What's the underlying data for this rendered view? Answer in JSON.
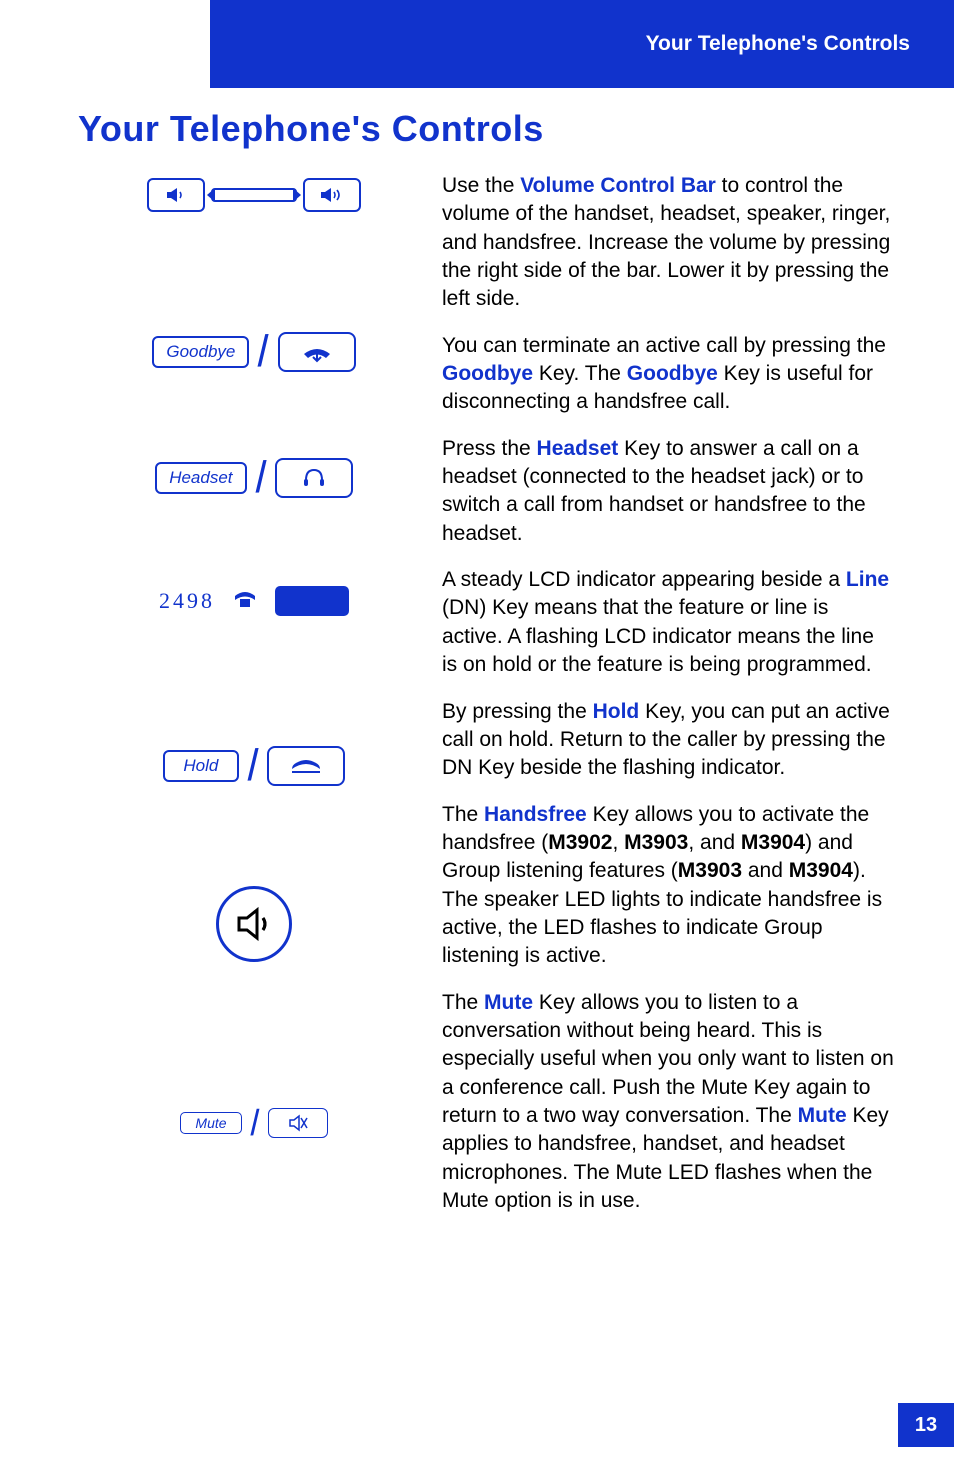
{
  "header": {
    "section": "Your Telephone's Controls"
  },
  "title": "Your Telephone's Controls",
  "keys": {
    "goodbye_label": "Goodbye",
    "headset_label": "Headset",
    "hold_label": "Hold",
    "mute_label": "Mute",
    "line_number": "2498"
  },
  "models": {
    "m3902": "M3902",
    "m3903": "M3903",
    "m3904": "M3904"
  },
  "terms": {
    "volume_bar": "Volume Control Bar",
    "goodbye": "Goodbye",
    "headset": "Headset",
    "line": "Line",
    "hold": "Hold",
    "handsfree": "Handsfree",
    "mute": "Mute"
  },
  "body": {
    "vol_1": "Use the ",
    "vol_2": " to control the volume of the handset, headset, speaker, ringer, and handsfree. Increase the volume by pressing the right side of the bar. Lower it by pressing the left side.",
    "goodbye_1": "You can terminate an active call by pressing the ",
    "goodbye_2": " Key. The ",
    "goodbye_3": " Key is useful for disconnecting a handsfree call.",
    "headset_1": "Press the ",
    "headset_2": " Key to answer a call on a headset (connected to the headset jack) or to switch a call from handset or handsfree to the headset.",
    "line_1": "A steady LCD indicator appearing beside a ",
    "line_2": " (DN) Key means that the feature or line is active. A flashing LCD indicator means the line is on hold or the feature is being programmed.",
    "hold_1": "By pressing the ",
    "hold_2": " Key, you can put an active call on hold. Return to the caller by pressing the DN Key beside the flashing indicator.",
    "hf_1": "The ",
    "hf_2": " Key allows you to activate the handsfree (",
    "hf_3": ", ",
    "hf_4": ", and ",
    "hf_5": ") and Group listening features (",
    "hf_6": " and ",
    "hf_7": "). The speaker LED lights to indicate handsfree is active, the LED flashes to indicate Group listening is active.",
    "mute_1": "The ",
    "mute_2": " Key allows you to listen to a conversation without being heard. This is especially useful when you only want to listen on a conference call. Push the Mute Key again to return to a two way conversation. The ",
    "mute_3": " Key applies to handsfree, handset, and headset microphones. The Mute LED flashes when the Mute option is in use."
  },
  "page_number": "13"
}
